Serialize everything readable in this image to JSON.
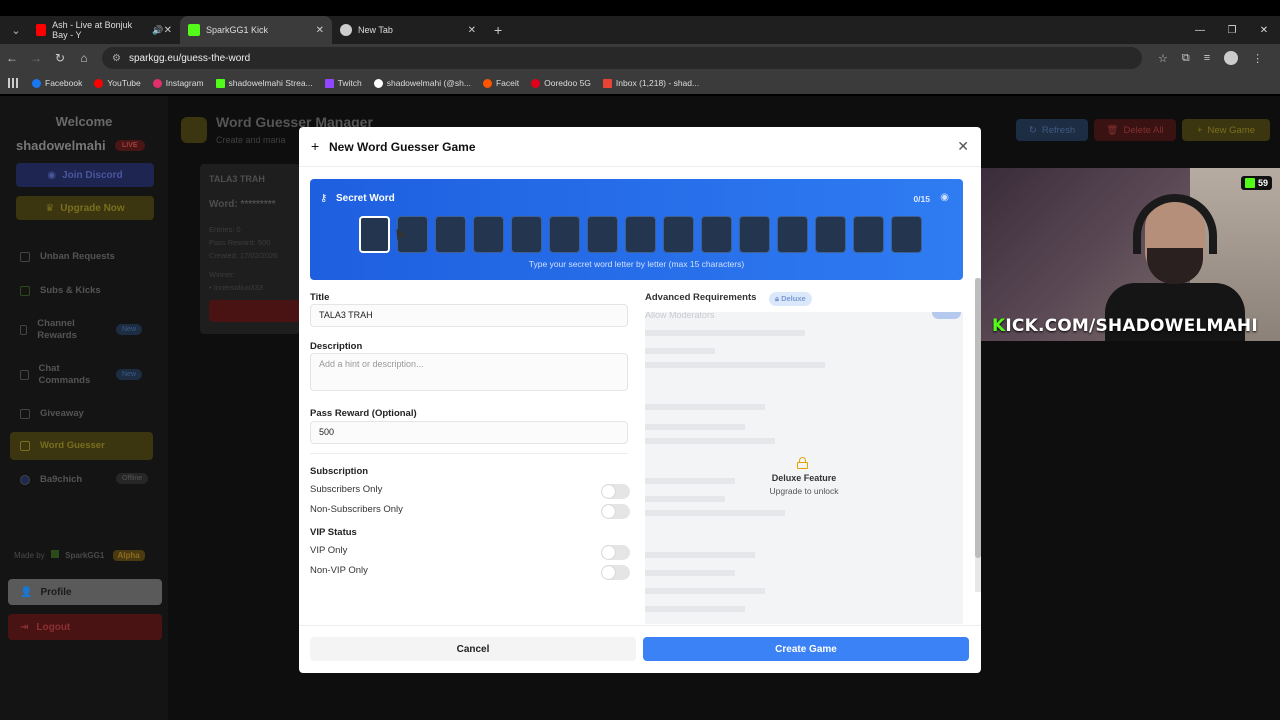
{
  "browser": {
    "tabs": [
      {
        "label": "Ash - Live at Bonjuk Bay - Y",
        "favicon_color": "#ff0000"
      },
      {
        "label": "SparkGG1 Kick",
        "favicon_color": "#53fc18"
      },
      {
        "label": "New Tab",
        "favicon_color": "#cccccc"
      }
    ],
    "url": "sparkgg.eu/guess-the-word",
    "bookmarks": [
      {
        "label": "Facebook",
        "color": "#1877f2"
      },
      {
        "label": "YouTube",
        "color": "#ff0000"
      },
      {
        "label": "Instagram",
        "color": "#e1306c"
      },
      {
        "label": "shadowelmahi Strea...",
        "color": "#53fc18"
      },
      {
        "label": "Twitch",
        "color": "#9146ff"
      },
      {
        "label": "shadowelmahi (@sh...",
        "color": "#ffffff"
      },
      {
        "label": "Faceit",
        "color": "#ff5500"
      },
      {
        "label": "Ooredoo 5G",
        "color": "#e2001a"
      },
      {
        "label": "Inbox (1,218) - shad...",
        "color": "#ea4335"
      }
    ]
  },
  "sidebar": {
    "welcome": "Welcome",
    "username": "shadowelmahi",
    "live_badge": "LIVE",
    "join_discord": "Join Discord",
    "upgrade_now": "Upgrade Now",
    "items": [
      {
        "label": "Unban Requests"
      },
      {
        "label": "Subs & Kicks"
      },
      {
        "label": "Channel Rewards",
        "badge": "New"
      },
      {
        "label": "Chat Commands",
        "badge": "New"
      },
      {
        "label": "Giveaway"
      },
      {
        "label": "Word Guesser"
      },
      {
        "label": "Ba9chich",
        "badge": "Offline"
      }
    ],
    "made_by": "Made by",
    "maker": "SparkGG1",
    "alpha": "Alpha",
    "profile": "Profile",
    "logout": "Logout"
  },
  "main": {
    "title": "Word Guesser Manager",
    "subtitle": "Create and mana",
    "refresh": "Refresh",
    "delete_all": "Delete All",
    "new_game": "New Game",
    "card": {
      "title": "TALA3 TRAH",
      "word": "Word: *********",
      "entries": "Entries: 0",
      "reward": "Pass Reward: 500",
      "created": "Created: 17/02/2026",
      "winner_label": "Winner:",
      "winner": "• Innersoliun333"
    }
  },
  "webcam": {
    "viewers": "59",
    "url_k": "K",
    "url_rest": "ICK.COM/SHADOWELMAHI"
  },
  "modal": {
    "title": "New Word Guesser Game",
    "secret_word": {
      "label": "Secret Word",
      "count": "0/15",
      "box_count": 15,
      "hint": "Type your secret word letter by letter (max 15 characters)"
    },
    "title_field": {
      "label": "Title",
      "value": "TALA3 TRAH"
    },
    "description_field": {
      "label": "Description",
      "placeholder": "Add a hint or description..."
    },
    "pass_reward": {
      "label": "Pass Reward (Optional)",
      "value": "500"
    },
    "subscription": {
      "label": "Subscription",
      "subscribers_only": "Subscribers Only",
      "non_subscribers_only": "Non-Subscribers Only"
    },
    "vip": {
      "label": "VIP Status",
      "vip_only": "VIP Only",
      "non_vip_only": "Non-VIP Only"
    },
    "advanced": {
      "title": "Advanced Requirements",
      "badge": "Deluxe",
      "allow_moderators": "Allow Moderators",
      "deluxe_feature": "Deluxe Feature",
      "upgrade_to_unlock": "Upgrade to unlock"
    },
    "cancel": "Cancel",
    "create": "Create Game"
  }
}
